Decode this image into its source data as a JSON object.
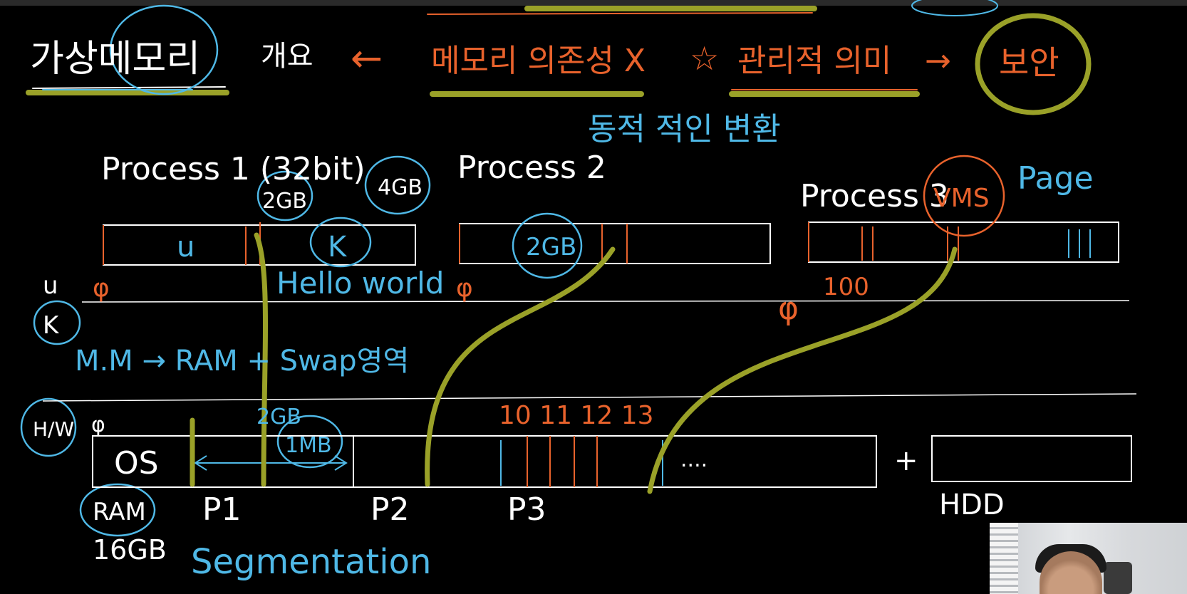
{
  "title": {
    "main": "가상메모리",
    "suffix": "개요",
    "arrow_left": "←",
    "topic": "메모리 의존성 X",
    "star": "☆",
    "mgmt": "관리적 의미",
    "arrow_right": "→",
    "result": "보안",
    "sub": "동적 적인 변환"
  },
  "process1": {
    "label": "Process 1 (32bit)",
    "user_mark": "u",
    "kernel_mark": "K",
    "size_2gb": "2GB",
    "size_4gb": "4GB"
  },
  "process2": {
    "label": "Process 2",
    "size_2gb": "2GB"
  },
  "process3": {
    "label": "Process 3",
    "vms": "VMS",
    "page": "Page",
    "offset": "100"
  },
  "zero": "φ",
  "hello_world": "Hello world",
  "left_labels": {
    "u": "u",
    "k": "K"
  },
  "mm_line": "M.M → RAM + Swap영역",
  "hw": {
    "badge": "H/W",
    "os": "OS",
    "p1": "P1",
    "p2": "P2",
    "p3": "P3",
    "ram": "RAM",
    "ram_size": "16GB",
    "size_2gb": "2GB",
    "size_1mb": "1MB",
    "numbers": "10 11 12 13",
    "dots": "....",
    "plus": "+",
    "hdd": "HDD"
  },
  "segmentation": "Segmentation",
  "colors": {
    "background": "#000000",
    "white_ink": "#ffffff",
    "orange_ink": "#e8622c",
    "blue_ink": "#4fb8e6",
    "highlight": "#9aa128"
  },
  "icons": [
    "webcam-thumbnail"
  ]
}
